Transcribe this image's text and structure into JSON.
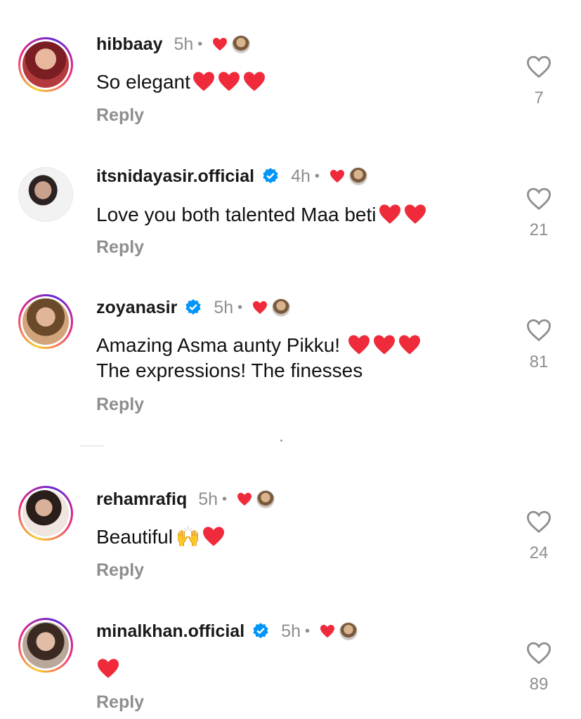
{
  "comments": [
    {
      "username": "hibbaay",
      "verified": false,
      "time": "5h",
      "text": "So elegant",
      "text_hearts": 3,
      "reply_label": "Reply",
      "likes": "7"
    },
    {
      "username": "itsnidayasir.official",
      "verified": true,
      "time": "4h",
      "text": "Love you both talented Maa beti",
      "text_hearts": 2,
      "reply_label": "Reply",
      "likes": "21"
    },
    {
      "username": "zoyanasir",
      "verified": true,
      "time": "5h",
      "text": "Amazing Asma aunty Pikku!",
      "text_line2": "The expressions! The finesses",
      "text_hearts": 3,
      "reply_label": "Reply",
      "likes": "81"
    },
    {
      "username": "rehamrafiq",
      "verified": false,
      "time": "5h",
      "text": "Beautiful",
      "text_emoji": "🙌",
      "text_hearts": 1,
      "reply_label": "Reply",
      "likes": "24"
    },
    {
      "username": "minalkhan.official",
      "verified": true,
      "time": "5h",
      "text": "",
      "text_hearts": 1,
      "reply_label": "Reply",
      "likes": "89"
    }
  ],
  "meta_separator": "•",
  "colors": {
    "accent_heart": "#ef2b3b",
    "verified_blue": "#0095f6",
    "muted": "#8e8e8e"
  },
  "icons": {
    "like": "heart-outline-icon",
    "creator_liked": "red-heart-icon",
    "verified": "verified-badge-icon"
  }
}
